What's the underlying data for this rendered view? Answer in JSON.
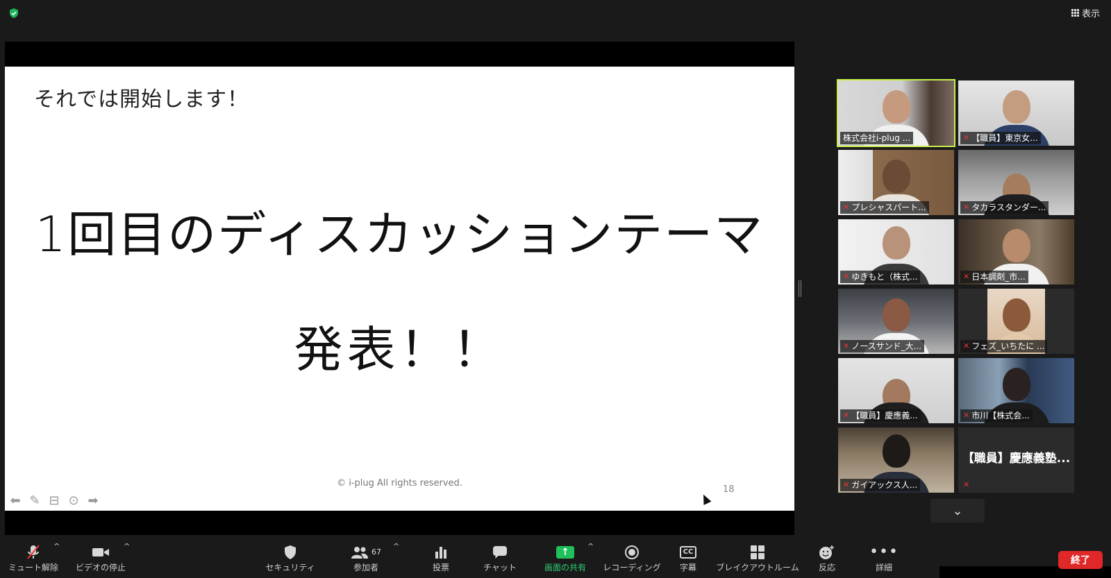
{
  "window": {
    "view_label": "表示"
  },
  "slide": {
    "heading": "それでは開始します！",
    "title": "1回目のディスカッションテーマ",
    "subtitle": "発表！！",
    "copyright": "© i-plug  All rights reserved.",
    "page_number": "18"
  },
  "gallery": {
    "participants": [
      {
        "name": "株式会社i-plug ...",
        "active": true,
        "muted": false
      },
      {
        "name": "【職員】東京女...",
        "active": false,
        "muted": true
      },
      {
        "name": "プレシャスパート...",
        "active": false,
        "muted": true
      },
      {
        "name": "タカラスタンダー...",
        "active": false,
        "muted": true
      },
      {
        "name": "ゆきもと（株式...",
        "active": false,
        "muted": true
      },
      {
        "name": "日本調剤_市...",
        "active": false,
        "muted": true
      },
      {
        "name": "ノースサンド_大...",
        "active": false,
        "muted": true
      },
      {
        "name": "フェズ_いちたに ...",
        "active": false,
        "muted": true
      },
      {
        "name": "【職員】慶應義...",
        "active": false,
        "muted": true
      },
      {
        "name": "市川【株式会...",
        "active": false,
        "muted": true
      },
      {
        "name": "ガイアックス人...",
        "active": false,
        "muted": true
      },
      {
        "name": "【職員】慶應義塾...",
        "active": false,
        "muted": true
      }
    ]
  },
  "toolbar": {
    "unmute_label": "ミュート解除",
    "video_label": "ビデオの停止",
    "security_label": "セキュリティ",
    "participants_label": "参加者",
    "participants_count": "67",
    "polls_label": "投票",
    "chat_label": "チャット",
    "share_label": "画面の共有",
    "record_label": "レコーディング",
    "captions_label": "字幕",
    "cc_text": "CC",
    "breakout_label": "ブレイクアウトルーム",
    "reactions_label": "反応",
    "more_label": "詳細",
    "end_label": "終了"
  },
  "colors": {
    "share_green": "#20c05c",
    "active_speaker": "#c7f04a",
    "end_red": "#e02828"
  }
}
